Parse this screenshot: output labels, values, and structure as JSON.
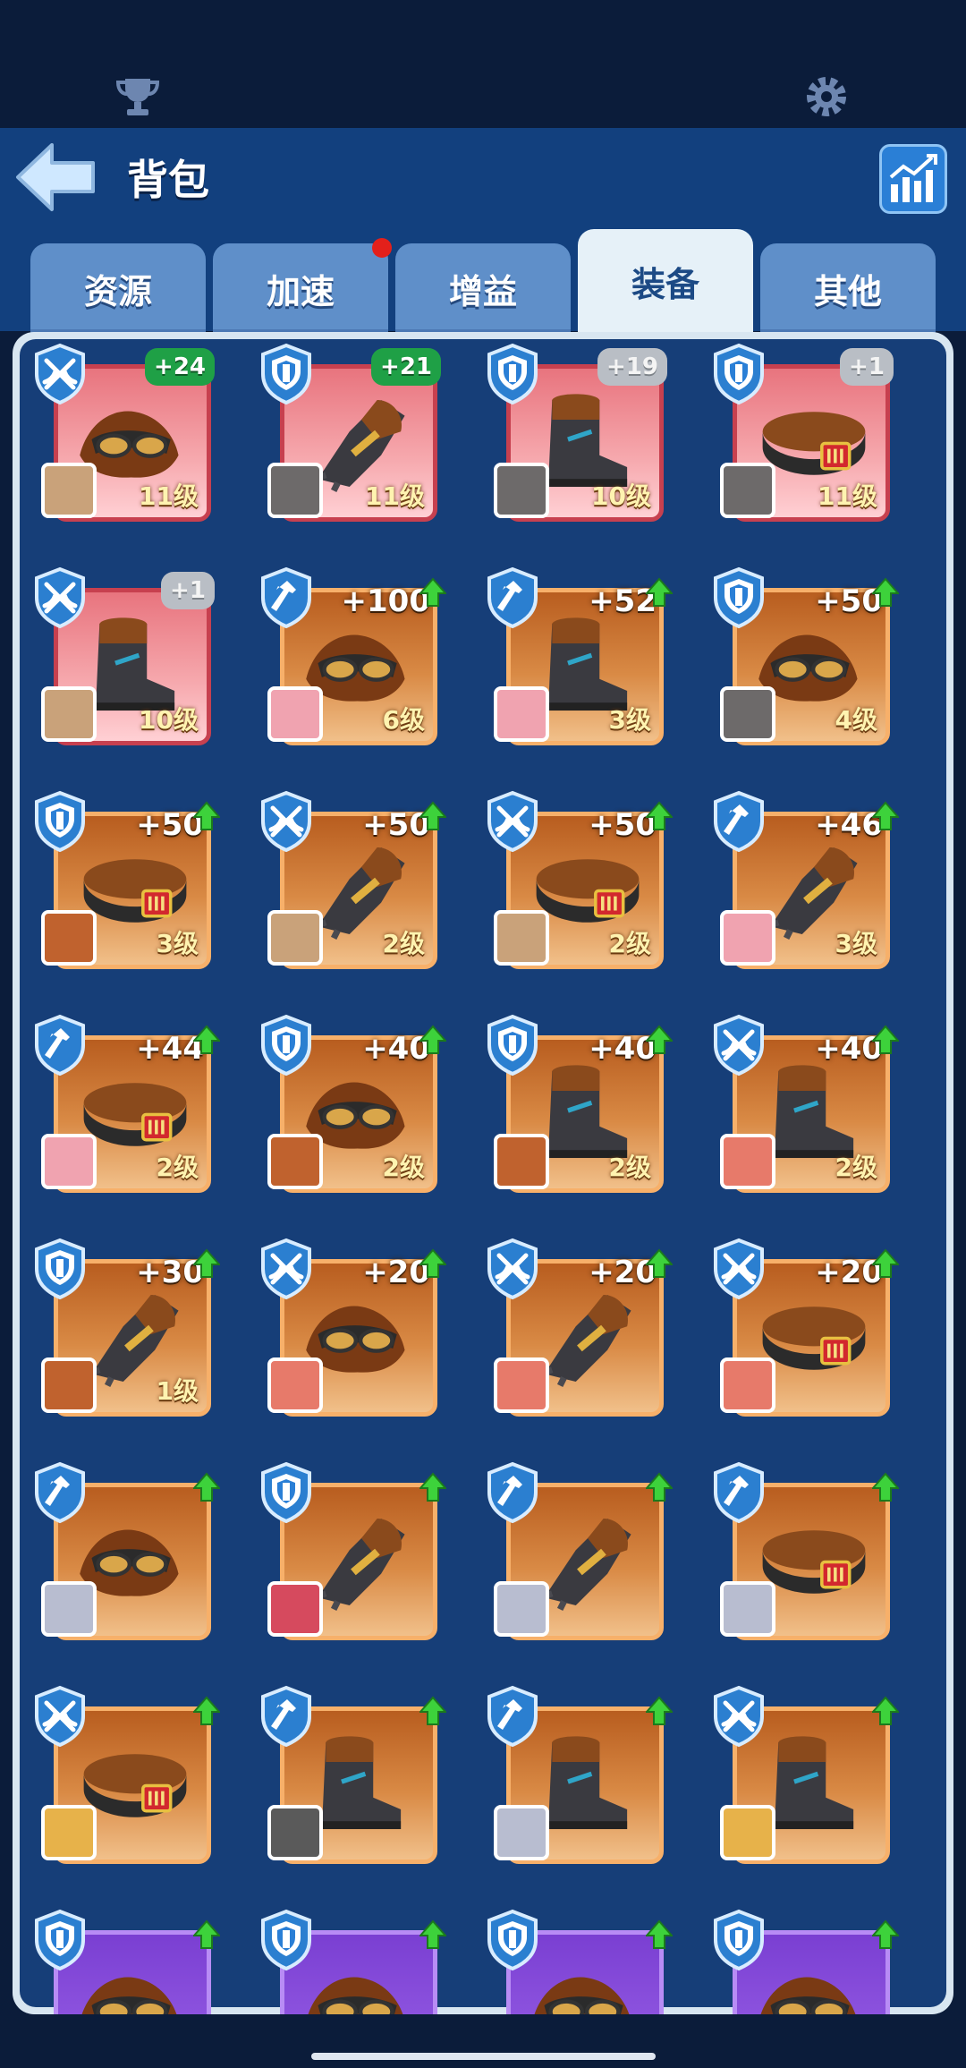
{
  "header": {
    "title": "背包"
  },
  "tabs": [
    {
      "label": "资源",
      "active": false
    },
    {
      "label": "加速",
      "active": false,
      "notification": true
    },
    {
      "label": "增益",
      "active": false
    },
    {
      "label": "装备",
      "active": true
    },
    {
      "label": "其他",
      "active": false
    }
  ],
  "colors": {
    "rarity_red": "#e8747e",
    "rarity_orange": "#d98a45",
    "rarity_purple": "#9b62e8",
    "bonus_green": "#1fa046",
    "bonus_gray": "#b9bec5",
    "upgrade_arrow": "#3dd23b"
  },
  "items": [
    {
      "class": "crossbow",
      "rarity": "red",
      "bonus": "+24",
      "bonus_style": "green",
      "upgrade": false,
      "level": "11级",
      "item": "goggles-helmet",
      "hero": "#c9a27a"
    },
    {
      "class": "shield",
      "rarity": "red",
      "bonus": "+21",
      "bonus_style": "green",
      "upgrade": false,
      "level": "11级",
      "item": "gauntlet",
      "hero": "#6d6a6a"
    },
    {
      "class": "shield",
      "rarity": "red",
      "bonus": "+19",
      "bonus_style": "gray",
      "upgrade": false,
      "level": "10级",
      "item": "boot",
      "hero": "#6d6a6a"
    },
    {
      "class": "shield",
      "rarity": "red",
      "bonus": "+1",
      "bonus_style": "gray",
      "upgrade": false,
      "level": "11级",
      "item": "belt",
      "hero": "#6d6a6a"
    },
    {
      "class": "crossbow",
      "rarity": "red",
      "bonus": "+1",
      "bonus_style": "gray",
      "upgrade": false,
      "level": "10级",
      "item": "boot",
      "hero": "#c9a27a"
    },
    {
      "class": "hammer",
      "rarity": "orange",
      "bonus": "+100",
      "bonus_style": "plain",
      "upgrade": true,
      "level": "6级",
      "item": "goggles-helmet",
      "hero": "#f0a3b0"
    },
    {
      "class": "hammer",
      "rarity": "orange",
      "bonus": "+52",
      "bonus_style": "plain",
      "upgrade": true,
      "level": "3级",
      "item": "boot",
      "hero": "#f0a3b0"
    },
    {
      "class": "shield",
      "rarity": "orange",
      "bonus": "+50",
      "bonus_style": "plain",
      "upgrade": true,
      "level": "4级",
      "item": "goggles-helmet",
      "hero": "#6d6a6a"
    },
    {
      "class": "shield",
      "rarity": "orange",
      "bonus": "+50",
      "bonus_style": "plain",
      "upgrade": true,
      "level": "3级",
      "item": "belt",
      "hero": "#c0622e"
    },
    {
      "class": "crossbow",
      "rarity": "orange",
      "bonus": "+50",
      "bonus_style": "plain",
      "upgrade": true,
      "level": "2级",
      "item": "gauntlet",
      "hero": "#c9a27a"
    },
    {
      "class": "crossbow",
      "rarity": "orange",
      "bonus": "+50",
      "bonus_style": "plain",
      "upgrade": true,
      "level": "2级",
      "item": "belt",
      "hero": "#c9a27a"
    },
    {
      "class": "hammer",
      "rarity": "orange",
      "bonus": "+46",
      "bonus_style": "plain",
      "upgrade": true,
      "level": "3级",
      "item": "gauntlet",
      "hero": "#f0a3b0"
    },
    {
      "class": "hammer",
      "rarity": "orange",
      "bonus": "+44",
      "bonus_style": "plain",
      "upgrade": true,
      "level": "2级",
      "item": "belt",
      "hero": "#f0a3b0"
    },
    {
      "class": "shield",
      "rarity": "orange",
      "bonus": "+40",
      "bonus_style": "plain",
      "upgrade": true,
      "level": "2级",
      "item": "goggles-helmet",
      "hero": "#c0622e"
    },
    {
      "class": "shield",
      "rarity": "orange",
      "bonus": "+40",
      "bonus_style": "plain",
      "upgrade": true,
      "level": "2级",
      "item": "boot",
      "hero": "#c0622e"
    },
    {
      "class": "crossbow",
      "rarity": "orange",
      "bonus": "+40",
      "bonus_style": "plain",
      "upgrade": true,
      "level": "2级",
      "item": "boot",
      "hero": "#e77a6a"
    },
    {
      "class": "shield",
      "rarity": "orange",
      "bonus": "+30",
      "bonus_style": "plain",
      "upgrade": true,
      "level": "1级",
      "item": "gauntlet",
      "hero": "#c0622e"
    },
    {
      "class": "crossbow",
      "rarity": "orange",
      "bonus": "+20",
      "bonus_style": "plain",
      "upgrade": true,
      "level": "",
      "item": "goggles-helmet",
      "hero": "#e77a6a"
    },
    {
      "class": "crossbow",
      "rarity": "orange",
      "bonus": "+20",
      "bonus_style": "plain",
      "upgrade": true,
      "level": "",
      "item": "gauntlet",
      "hero": "#e77a6a"
    },
    {
      "class": "crossbow",
      "rarity": "orange",
      "bonus": "+20",
      "bonus_style": "plain",
      "upgrade": true,
      "level": "",
      "item": "belt",
      "hero": "#e77a6a"
    },
    {
      "class": "hammer",
      "rarity": "orange",
      "bonus": "",
      "bonus_style": "plain",
      "upgrade": true,
      "level": "",
      "item": "goggles-helmet",
      "hero": "#b8bdd0"
    },
    {
      "class": "shield",
      "rarity": "orange",
      "bonus": "",
      "bonus_style": "plain",
      "upgrade": true,
      "level": "",
      "item": "gauntlet",
      "hero": "#d64a5e"
    },
    {
      "class": "hammer",
      "rarity": "orange",
      "bonus": "",
      "bonus_style": "plain",
      "upgrade": true,
      "level": "",
      "item": "gauntlet",
      "hero": "#b8bdd0"
    },
    {
      "class": "hammer",
      "rarity": "orange",
      "bonus": "",
      "bonus_style": "plain",
      "upgrade": true,
      "level": "",
      "item": "belt",
      "hero": "#b8bdd0"
    },
    {
      "class": "crossbow",
      "rarity": "orange",
      "bonus": "",
      "bonus_style": "plain",
      "upgrade": true,
      "level": "",
      "item": "belt",
      "hero": "#e7b24a"
    },
    {
      "class": "hammer",
      "rarity": "orange",
      "bonus": "",
      "bonus_style": "plain",
      "upgrade": true,
      "level": "",
      "item": "boot",
      "hero": "#5a5a5a"
    },
    {
      "class": "hammer",
      "rarity": "orange",
      "bonus": "",
      "bonus_style": "plain",
      "upgrade": true,
      "level": "",
      "item": "boot",
      "hero": "#b8bdd0"
    },
    {
      "class": "crossbow",
      "rarity": "orange",
      "bonus": "",
      "bonus_style": "plain",
      "upgrade": true,
      "level": "",
      "item": "boot",
      "hero": "#e7b24a"
    },
    {
      "class": "shield",
      "rarity": "purple",
      "bonus": "",
      "bonus_style": "plain",
      "upgrade": true,
      "level": "",
      "item": "goggles-helmet",
      "hero": ""
    },
    {
      "class": "shield",
      "rarity": "purple",
      "bonus": "",
      "bonus_style": "plain",
      "upgrade": true,
      "level": "",
      "item": "goggles-helmet",
      "hero": ""
    },
    {
      "class": "shield",
      "rarity": "purple",
      "bonus": "",
      "bonus_style": "plain",
      "upgrade": true,
      "level": "",
      "item": "goggles-helmet",
      "hero": ""
    },
    {
      "class": "shield",
      "rarity": "purple",
      "bonus": "",
      "bonus_style": "plain",
      "upgrade": true,
      "level": "",
      "item": "goggles-helmet",
      "hero": ""
    }
  ]
}
